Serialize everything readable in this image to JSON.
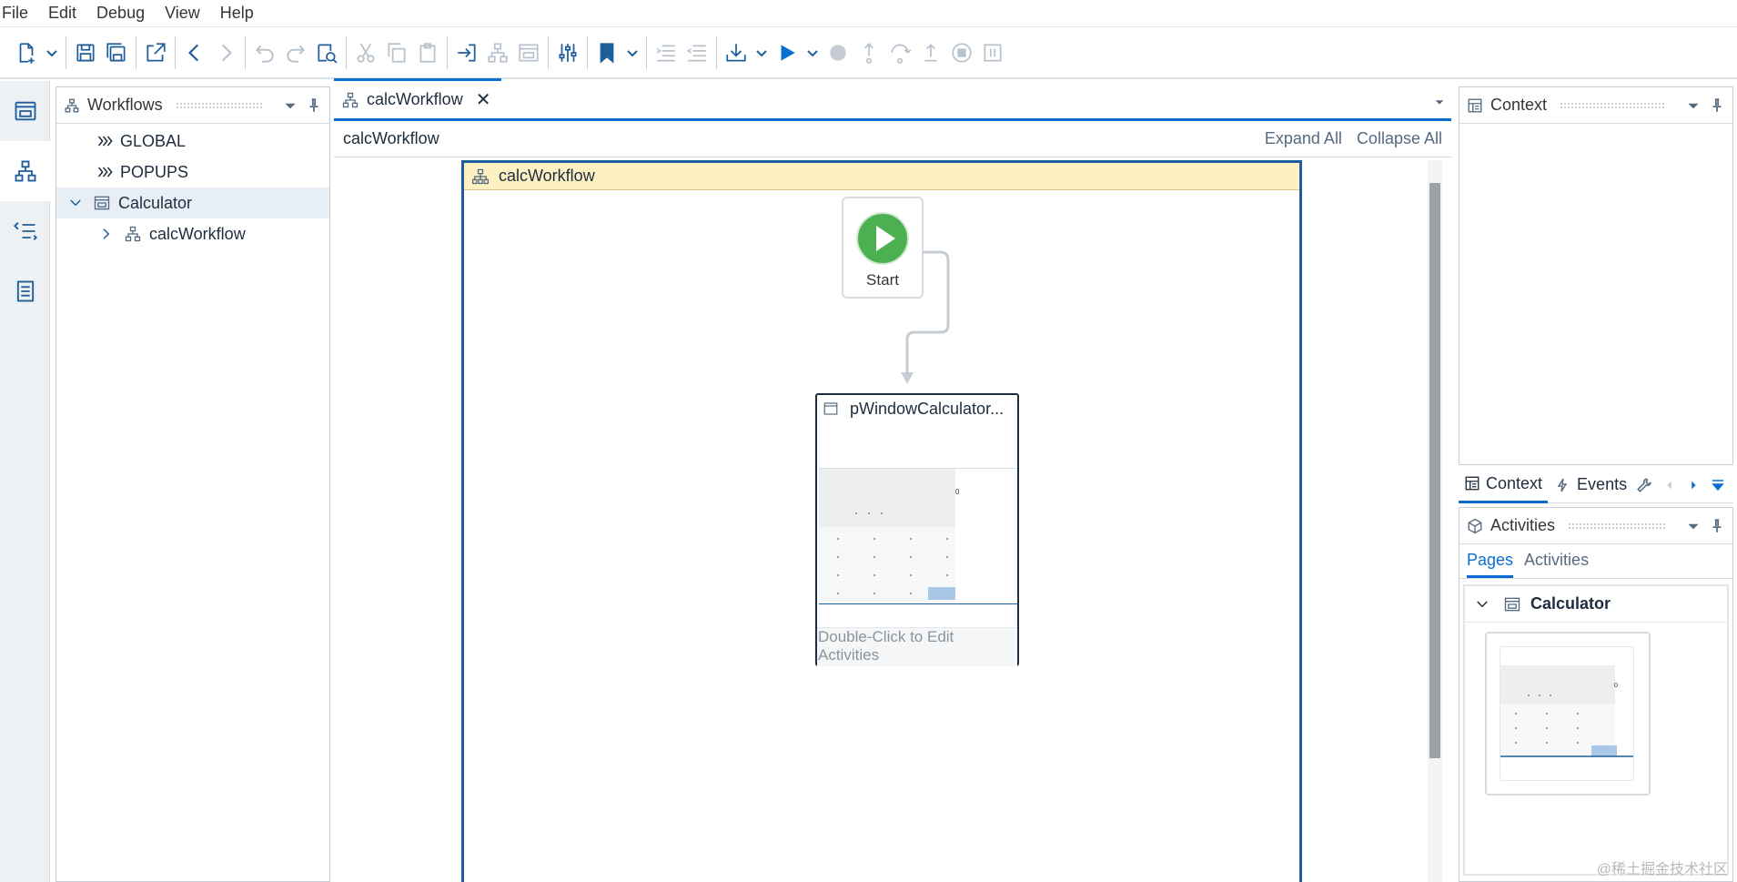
{
  "menu": [
    "File",
    "Edit",
    "Debug",
    "View",
    "Help"
  ],
  "left_panel": {
    "title": "Workflows",
    "tree": [
      {
        "label": "GLOBAL"
      },
      {
        "label": "POPUPS"
      },
      {
        "label": "Calculator"
      },
      {
        "label": "calcWorkflow"
      }
    ]
  },
  "editor": {
    "tab_label": "calcWorkflow",
    "tab_close": "✕",
    "breadcrumb": "calcWorkflow",
    "expand_all": "Expand All",
    "collapse_all": "Collapse All",
    "workflow_title": "calcWorkflow",
    "start_label": "Start",
    "activity_title": "pWindowCalculator...",
    "activity_hint": "Double-Click to Edit Activities",
    "thumb_value": "0"
  },
  "right_top_panel": {
    "title": "Context"
  },
  "right_tabs": {
    "context": "Context",
    "events": "Events"
  },
  "right_bottom_panel": {
    "title": "Activities",
    "tabs": [
      "Pages",
      "Activities"
    ],
    "group_label": "Calculator",
    "thumb_value": "0"
  },
  "watermark": "@稀土掘金技术社区",
  "colors": {
    "accent": "#0a6ed1",
    "workflow_header": "#fdf0c2",
    "start_green": "#4caf50",
    "selected_row": "#e7eef6"
  }
}
